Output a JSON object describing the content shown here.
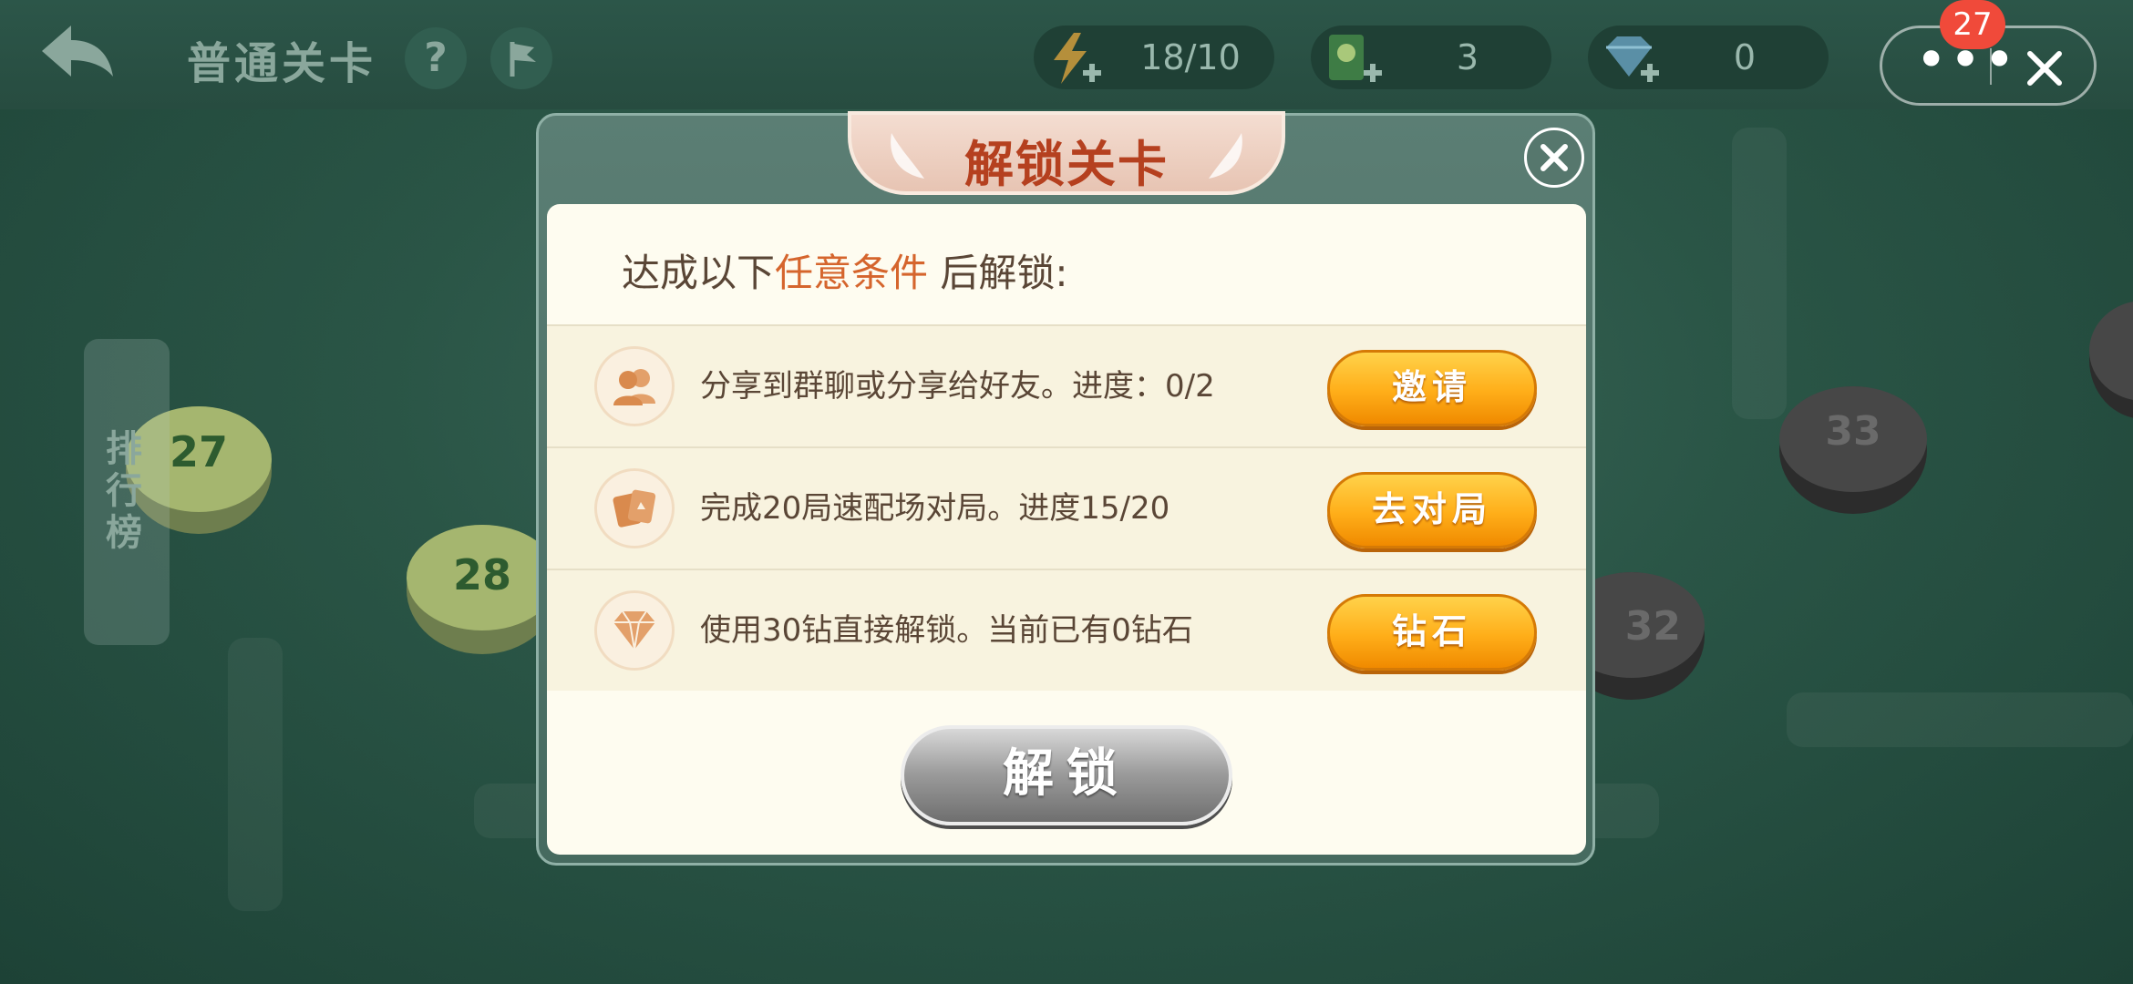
{
  "top_bar": {
    "title": "普通关卡",
    "help_label": "?",
    "energy": "18/10",
    "hints": "3",
    "diamonds": "0",
    "notification_count": "27"
  },
  "sidebar": {
    "rank_label": "排行榜"
  },
  "map": {
    "levels": [
      "27",
      "28",
      "32",
      "33"
    ]
  },
  "modal": {
    "title": "解锁关卡",
    "header_prefix": "达成以下",
    "header_highlight": "任意条件",
    "header_suffix": "后解锁:",
    "conditions": [
      {
        "icon": "friends-icon",
        "text": "分享到群聊或分享给好友。进度：0/2",
        "button": "邀请"
      },
      {
        "icon": "cards-icon",
        "text": "完成20局速配场对局。进度15/20",
        "button": "去对局"
      },
      {
        "icon": "diamond-icon",
        "text": "使用30钻直接解锁。当前已有0钻石",
        "button": "钻石"
      }
    ],
    "unlock_button": "解锁"
  },
  "colors": {
    "accent_orange": "#ffae19",
    "highlight_text": "#d5652d",
    "badge_red": "#f04a3a"
  }
}
